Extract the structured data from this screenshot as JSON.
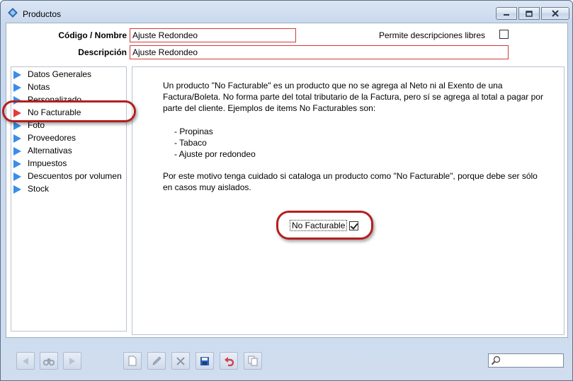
{
  "window": {
    "title": "Productos"
  },
  "form": {
    "codigo_label": "Código / Nombre",
    "codigo_value": "Ajuste Redondeo",
    "descripcion_label": "Descripción",
    "descripcion_value": "Ajuste Redondeo",
    "permite_label": "Permite descripciones libres",
    "permite_checked": false
  },
  "nav": {
    "items": [
      {
        "label": "Datos Generales",
        "active": false
      },
      {
        "label": "Notas",
        "active": false
      },
      {
        "label": "Personalizado",
        "active": false
      },
      {
        "label": "No Facturable",
        "active": true
      },
      {
        "label": "Foto",
        "active": false
      },
      {
        "label": "Proveedores",
        "active": false
      },
      {
        "label": "Alternativas",
        "active": false
      },
      {
        "label": "Impuestos",
        "active": false
      },
      {
        "label": "Descuentos por volumen",
        "active": false
      },
      {
        "label": "Stock",
        "active": false
      }
    ]
  },
  "content": {
    "paragraph1": "Un producto \"No Facturable\" es un producto que no se agrega al Neto ni al Exento de una Factura/Boleta. No forma parte del total tributario de la Factura, pero sí se agrega al total a pagar por parte del cliente. Ejemplos de items No Facturables son:",
    "examples": [
      "- Propinas",
      "- Tabaco",
      "- Ajuste por redondeo"
    ],
    "paragraph2": "Por este motivo tenga cuidado si cataloga un producto como \"No Facturable\", porque debe ser sólo en casos muy aislados.",
    "no_facturable_label": "No Facturable",
    "no_facturable_checked": true
  },
  "toolbar": {
    "buttons": [
      "prev-icon",
      "binoculars-icon",
      "next-icon",
      "new-document-icon",
      "edit-pencil-icon",
      "delete-x-icon",
      "save-disk-icon",
      "undo-icon",
      "copy-icon"
    ]
  },
  "search": {
    "value": ""
  },
  "colors": {
    "highlight": "#b31f1f",
    "nav_arrow": "#3a8ee6",
    "nav_arrow_active": "#e23b3b",
    "field_border": "#d23b3b"
  }
}
